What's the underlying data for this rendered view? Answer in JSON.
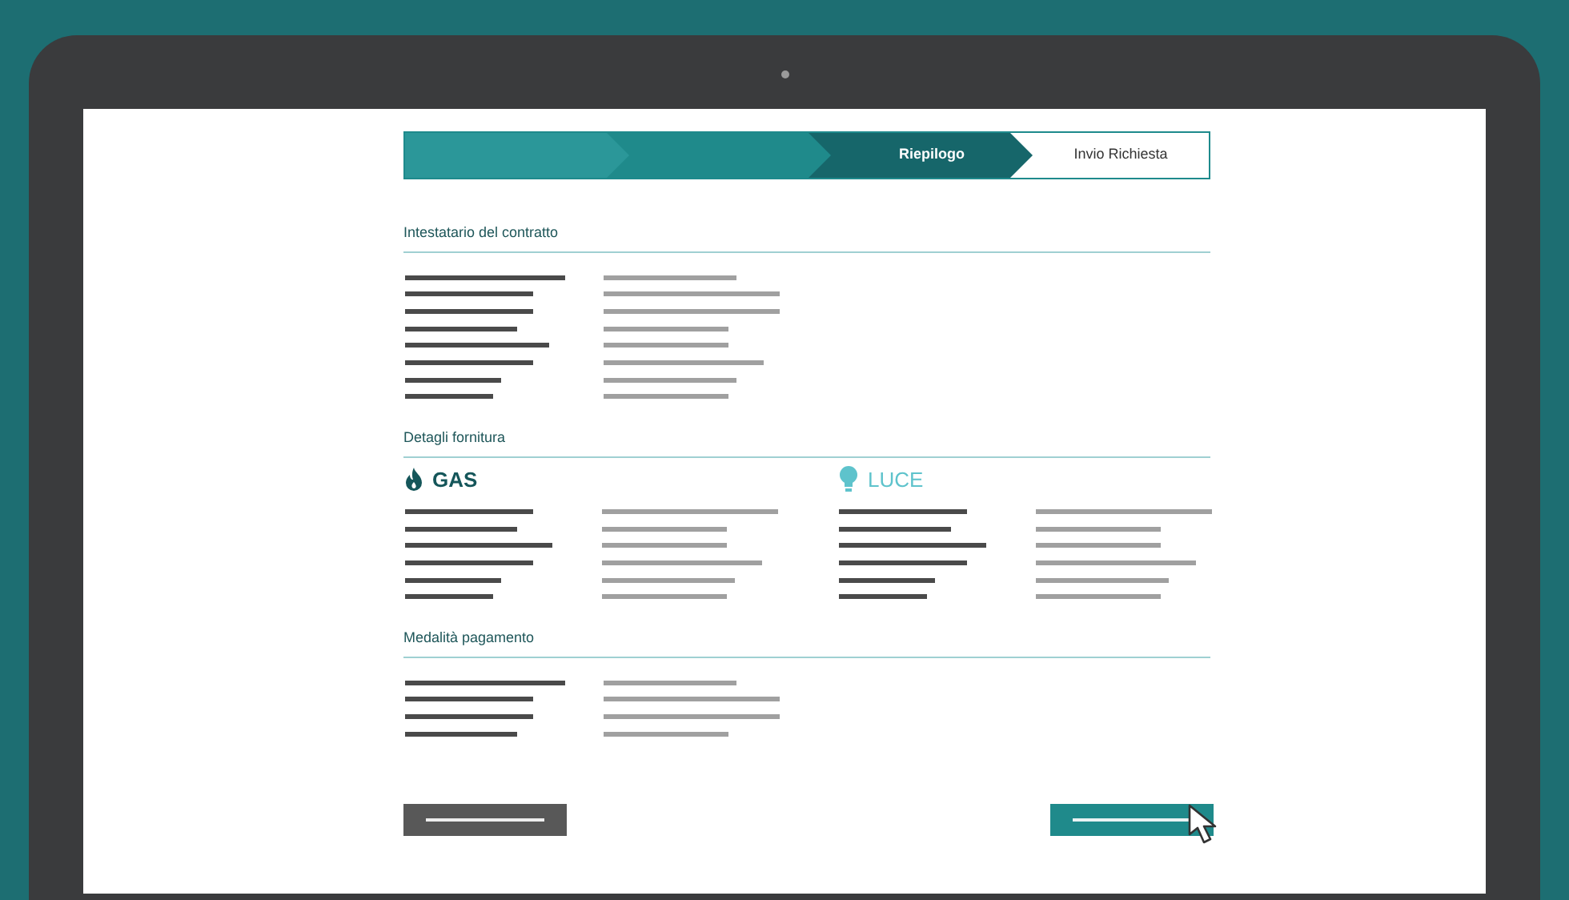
{
  "stepper": [
    {
      "completed": true,
      "selected": false
    },
    {
      "completed": true,
      "selected": false
    },
    {
      "label": "Riepilogo",
      "completed": false,
      "selected": true
    },
    {
      "label": "Invio Richiesta",
      "completed": false,
      "selected": false
    }
  ],
  "sections": [
    {
      "heading": "Intestatario del contratto",
      "kind": "plain"
    },
    {
      "heading": "Detagli fornitura",
      "kind": "supply",
      "supplies": [
        {
          "label": "GAS",
          "kind": "gas"
        },
        {
          "label": "LUCE",
          "kind": "power"
        }
      ]
    },
    {
      "heading": "Medalità pagamento",
      "kind": "plain"
    }
  ],
  "buttons": [
    {
      "kind": "back"
    },
    {
      "kind": "next"
    }
  ]
}
